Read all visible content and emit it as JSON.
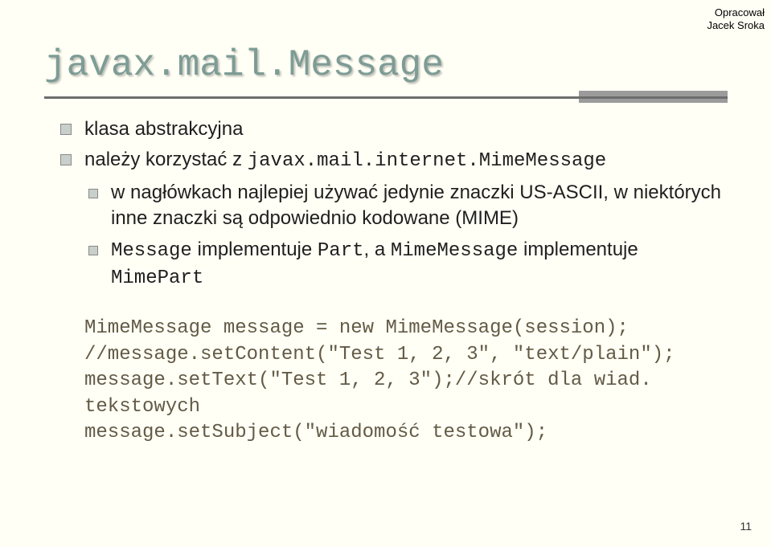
{
  "attribution": {
    "line1": "Opracował",
    "line2": "Jacek Sroka"
  },
  "title": "javax.mail.Message",
  "bullets": {
    "b1": "klasa abstrakcyjna",
    "b2_pre": "należy korzystać z ",
    "b2_code": "javax.mail.internet.MimeMessage",
    "b3": "w nagłówkach najlepiej używać jedynie znaczki US-ASCII, w niektórych inne znaczki są odpowiednio kodowane (MIME)",
    "b4_c1": "Message",
    "b4_t1": " implementuje ",
    "b4_c2": "Part",
    "b4_t2": ", a ",
    "b4_c3": "MimeMessage",
    "b4_t3": " implementuje ",
    "b4_c4": "MimePart"
  },
  "code": {
    "l1": "MimeMessage message = new MimeMessage(session);",
    "l2": "//message.setContent(\"Test 1, 2, 3\", \"text/plain\");",
    "l3": "message.setText(\"Test 1, 2, 3\");//skrót dla wiad. tekstowych",
    "l4": "message.setSubject(\"wiadomość testowa\");"
  },
  "page_number": "11"
}
